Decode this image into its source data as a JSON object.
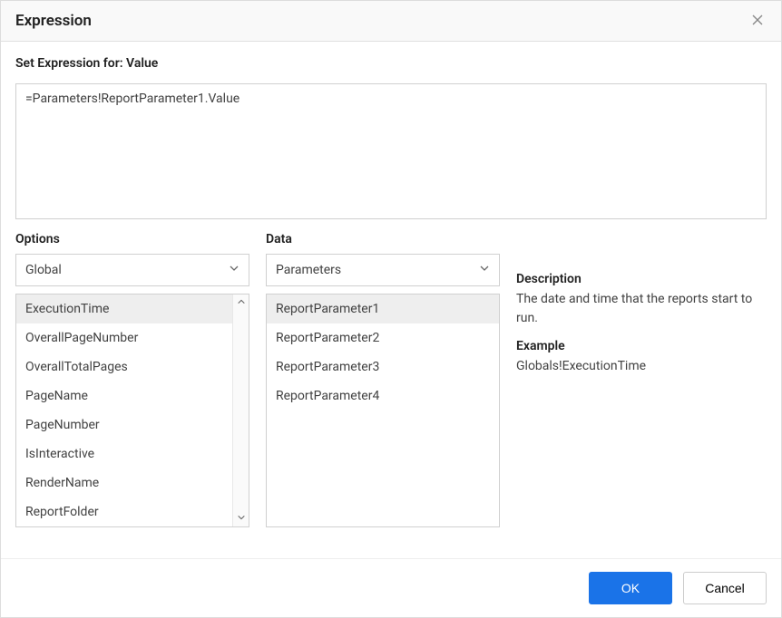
{
  "dialog": {
    "title": "Expression",
    "subtitle": "Set Expression for: Value",
    "expression_value": "=Parameters!ReportParameter1.Value"
  },
  "options": {
    "label": "Options",
    "selected": "Global",
    "items": [
      "ExecutionTime",
      "OverallPageNumber",
      "OverallTotalPages",
      "PageName",
      "PageNumber",
      "IsInteractive",
      "RenderName",
      "ReportFolder"
    ],
    "selected_item_index": 0
  },
  "data": {
    "label": "Data",
    "selected": "Parameters",
    "items": [
      "ReportParameter1",
      "ReportParameter2",
      "ReportParameter3",
      "ReportParameter4"
    ],
    "selected_item_index": 0
  },
  "info": {
    "description_label": "Description",
    "description_text": "The date and time that the reports start to run.",
    "example_label": "Example",
    "example_text": "Globals!ExecutionTime"
  },
  "footer": {
    "ok_label": "OK",
    "cancel_label": "Cancel"
  }
}
